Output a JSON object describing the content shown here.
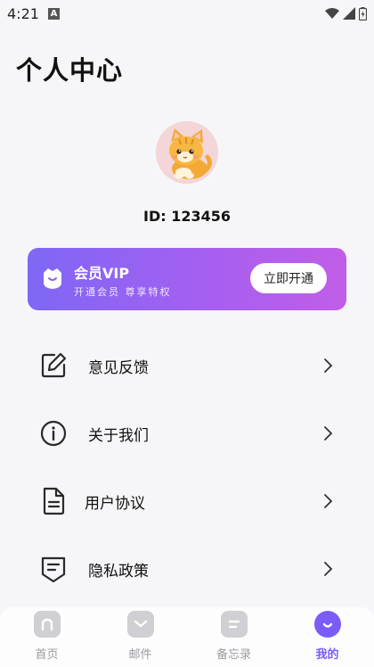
{
  "status_bar": {
    "time": "4:21",
    "indicator": "A"
  },
  "page": {
    "title": "个人中心"
  },
  "profile": {
    "id_text": "ID: 123456"
  },
  "vip": {
    "title": "会员VIP",
    "subtitle": "开通会员  尊享特权",
    "button_label": "立即开通",
    "gradient": [
      "#7f67f5",
      "#c15ee8"
    ]
  },
  "menu": [
    {
      "label": "意见反馈",
      "icon": "edit-icon"
    },
    {
      "label": "关于我们",
      "icon": "info-icon"
    },
    {
      "label": "用户协议",
      "icon": "document-icon"
    },
    {
      "label": "隐私政策",
      "icon": "shield-text-icon"
    }
  ],
  "tabs": [
    {
      "label": "首页",
      "icon": "home-icon",
      "active": false
    },
    {
      "label": "邮件",
      "icon": "mail-icon",
      "active": false
    },
    {
      "label": "备忘录",
      "icon": "memo-icon",
      "active": false
    },
    {
      "label": "我的",
      "icon": "profile-smile-icon",
      "active": true
    }
  ],
  "colors": {
    "accent": "#7b5cf6",
    "inactive_tab": "#cfcfd4",
    "background": "#f6f6f8"
  }
}
